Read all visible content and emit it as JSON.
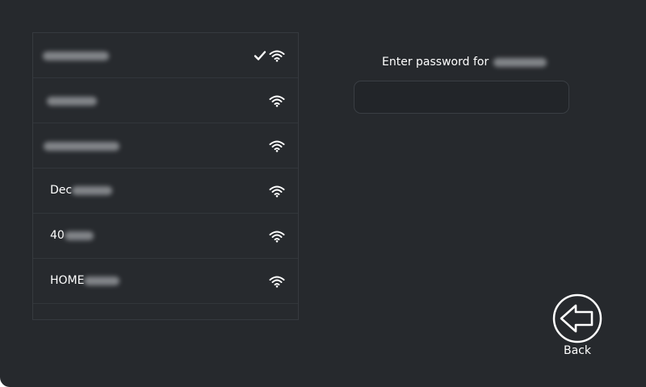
{
  "colors": {
    "background": "#26292d",
    "list_border": "#363a3f",
    "text": "#ffffff",
    "field_background": "#222529"
  },
  "networks": [
    {
      "ssid": "",
      "connected": true,
      "icon": "wifi-icon"
    },
    {
      "ssid": "",
      "connected": false,
      "icon": "wifi-icon"
    },
    {
      "ssid": "",
      "connected": false,
      "icon": "wifi-icon"
    },
    {
      "ssid": "Dec",
      "connected": false,
      "icon": "wifi-icon"
    },
    {
      "ssid": "40",
      "connected": false,
      "icon": "wifi-icon"
    },
    {
      "ssid": "HOME",
      "connected": false,
      "icon": "wifi-icon"
    }
  ],
  "password_panel": {
    "prompt": "Enter password for",
    "value": ""
  },
  "back": {
    "label": "Back",
    "icon": "back-arrow-icon"
  }
}
